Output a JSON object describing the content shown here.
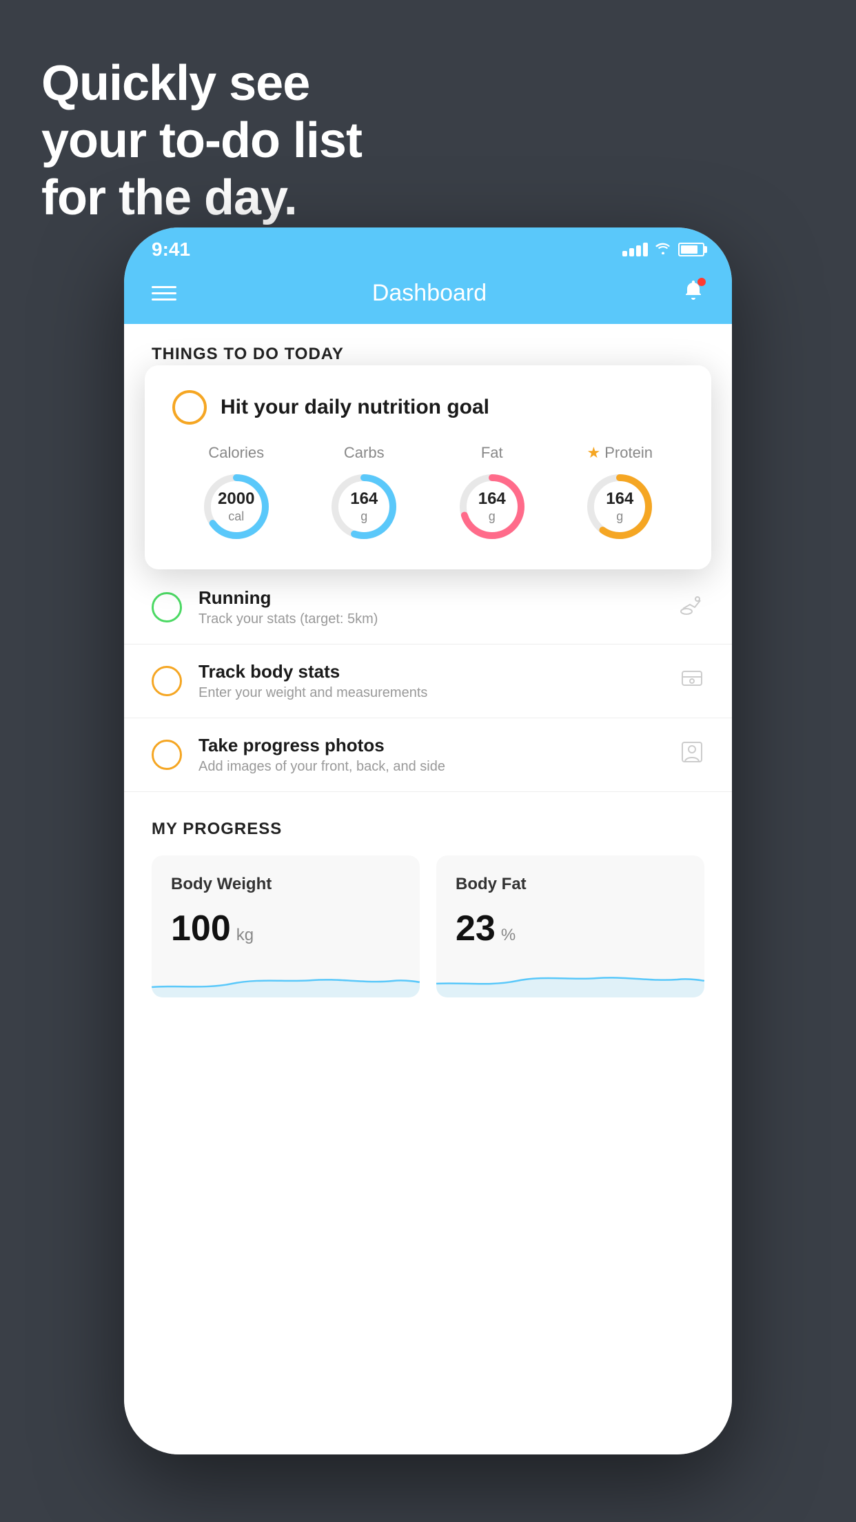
{
  "background_color": "#3a3f47",
  "hero": {
    "line1": "Quickly see",
    "line2": "your to-do list",
    "line3": "for the day."
  },
  "phone": {
    "status_bar": {
      "time": "9:41"
    },
    "header": {
      "title": "Dashboard"
    },
    "things_section": {
      "title": "THINGS TO DO TODAY"
    },
    "floating_card": {
      "check_label": "Hit your daily nutrition goal",
      "nutrition": [
        {
          "label": "Calories",
          "value": "2000",
          "unit": "cal",
          "color": "#5ac8fa",
          "starred": false,
          "percent": 65
        },
        {
          "label": "Carbs",
          "value": "164",
          "unit": "g",
          "color": "#5ac8fa",
          "starred": false,
          "percent": 55
        },
        {
          "label": "Fat",
          "value": "164",
          "unit": "g",
          "color": "#ff6b8a",
          "starred": false,
          "percent": 70
        },
        {
          "label": "Protein",
          "value": "164",
          "unit": "g",
          "color": "#f5a623",
          "starred": true,
          "percent": 60
        }
      ]
    },
    "todo_items": [
      {
        "id": "running",
        "circle_color": "green",
        "title": "Running",
        "subtitle": "Track your stats (target: 5km)",
        "icon": "shoe"
      },
      {
        "id": "body-stats",
        "circle_color": "yellow",
        "title": "Track body stats",
        "subtitle": "Enter your weight and measurements",
        "icon": "scale"
      },
      {
        "id": "progress-photos",
        "circle_color": "yellow",
        "title": "Take progress photos",
        "subtitle": "Add images of your front, back, and side",
        "icon": "person"
      }
    ],
    "progress": {
      "title": "MY PROGRESS",
      "cards": [
        {
          "id": "body-weight",
          "title": "Body Weight",
          "value": "100",
          "unit": "kg"
        },
        {
          "id": "body-fat",
          "title": "Body Fat",
          "value": "23",
          "unit": "%"
        }
      ]
    }
  }
}
